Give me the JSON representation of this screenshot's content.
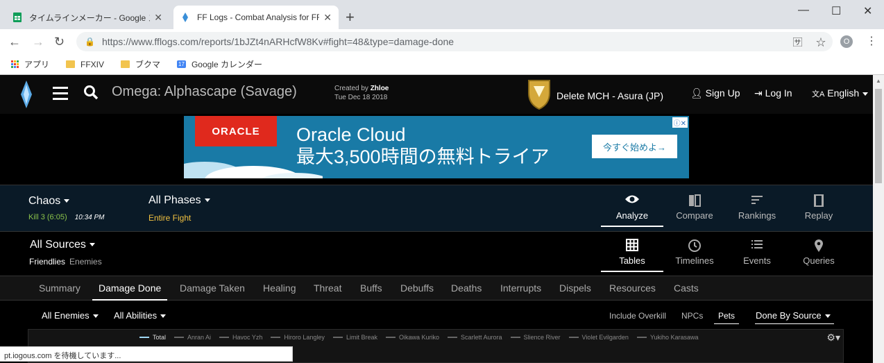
{
  "browser": {
    "tabs": [
      {
        "title": "タイムラインメーカー - Google スプレッ",
        "favicon": "sheets-icon"
      },
      {
        "title": "FF Logs - Combat Analysis for FF",
        "favicon": "fflogs-icon"
      }
    ],
    "url": "https://www.fflogs.com/reports/1bJZt4nARHcfW8Kv#fight=48&type=damage-done",
    "profile_initial": "O",
    "bookmarks": [
      {
        "label": "アプリ",
        "icon": "apps-icon"
      },
      {
        "label": "FFXIV",
        "icon": "folder-icon"
      },
      {
        "label": "ブクマ",
        "icon": "folder-icon"
      },
      {
        "label": "Google カレンダー",
        "icon": "calendar-icon",
        "badge": "17"
      }
    ],
    "status": "pt.iogous.com を待機しています..."
  },
  "header": {
    "zone": "Omega: Alphascape (Savage)",
    "created_prefix": "Created by",
    "creator": "Zhloe",
    "date": "Tue Dec 18 2018",
    "guild": "Delete MCH - Asura (JP)",
    "signup": "Sign Up",
    "login": "Log In",
    "language": "English"
  },
  "ad": {
    "brand": "ORACLE",
    "line1": "Oracle Cloud",
    "line2": "最大3,500時間の無料トライア",
    "cta": "今すぐ始めよ→"
  },
  "fight": {
    "name": "Chaos",
    "kill": "Kill 3 (6:05)",
    "time": "10:34 PM",
    "phase": "All Phases",
    "phase_sub": "Entire Fight"
  },
  "view_nav": [
    {
      "label": "Analyze",
      "icon": "eye-icon",
      "selected": true
    },
    {
      "label": "Compare",
      "icon": "compare-icon",
      "selected": false
    },
    {
      "label": "Rankings",
      "icon": "rankings-icon",
      "selected": false
    },
    {
      "label": "Replay",
      "icon": "film-icon",
      "selected": false
    }
  ],
  "sources": {
    "title": "All Sources",
    "friendlies": "Friendlies",
    "enemies": "Enemies"
  },
  "mode_nav": [
    {
      "label": "Tables",
      "icon": "grid-icon",
      "selected": true
    },
    {
      "label": "Timelines",
      "icon": "clock-icon",
      "selected": false
    },
    {
      "label": "Events",
      "icon": "list-icon",
      "selected": false
    },
    {
      "label": "Queries",
      "icon": "pin-icon",
      "selected": false
    }
  ],
  "tabs": [
    "Summary",
    "Damage Done",
    "Damage Taken",
    "Healing",
    "Threat",
    "Buffs",
    "Debuffs",
    "Deaths",
    "Interrupts",
    "Dispels",
    "Resources",
    "Casts"
  ],
  "selected_tab": "Damage Done",
  "filters": {
    "enemies": "All Enemies",
    "abilities": "All Abilities",
    "overkill": "Include Overkill",
    "npcs": "NPCs",
    "pets": "Pets",
    "done_by": "Done By Source"
  },
  "legend": [
    "Total",
    "Anran Ai",
    "Havoc Yzh",
    "Hiroro Langley",
    "Limit Break",
    "Oikawa Kuriko",
    "Scarlett Aurora",
    "Slience River",
    "Violet Evilgarden",
    "Yukiho Karasawa"
  ],
  "colors": {
    "accent_gold": "#f0c040",
    "kill_green": "#8bc34a",
    "oracle_red": "#e0291d",
    "ad_blue": "#197aa6"
  }
}
